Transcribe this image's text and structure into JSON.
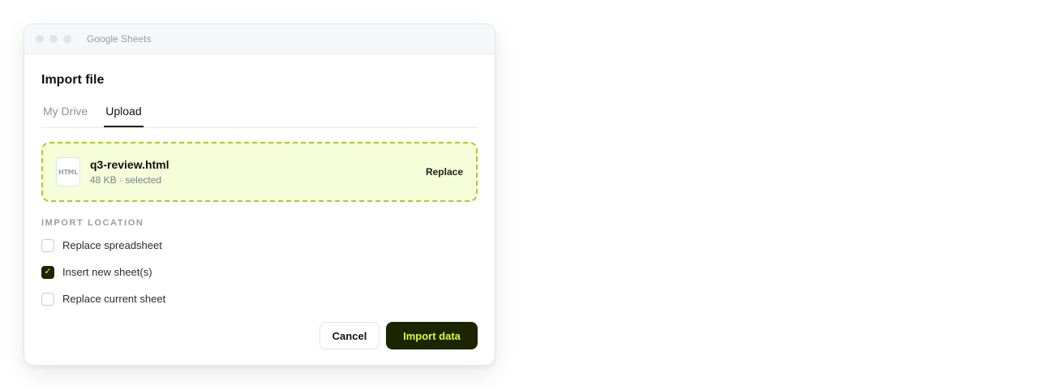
{
  "window": {
    "app_title": "Google Sheets"
  },
  "dialog": {
    "title": "Import file",
    "tabs": [
      {
        "label": "My Drive",
        "active": false
      },
      {
        "label": "Upload",
        "active": true
      }
    ],
    "file": {
      "icon_label": "HTML",
      "name": "q3-review.html",
      "meta": "48 KB · selected",
      "replace_label": "Replace"
    },
    "section_label": "IMPORT LOCATION",
    "options": [
      {
        "label": "Replace spreadsheet",
        "checked": false
      },
      {
        "label": "Insert new sheet(s)",
        "checked": true
      },
      {
        "label": "Replace current sheet",
        "checked": false
      }
    ],
    "check_glyph": "✓",
    "buttons": {
      "cancel": "Cancel",
      "primary": "Import data"
    }
  },
  "colors": {
    "accent_dark": "#1c2400",
    "accent_lime": "#d8ff3a",
    "dropzone_bg": "#f6fdd9",
    "dropzone_border": "#a8cc2a"
  },
  "icons": {
    "window_controls": [
      "window-dot-icon",
      "window-dot-icon",
      "window-dot-icon"
    ],
    "file": "html-file-icon",
    "checkbox_check": "checkmark-icon"
  }
}
